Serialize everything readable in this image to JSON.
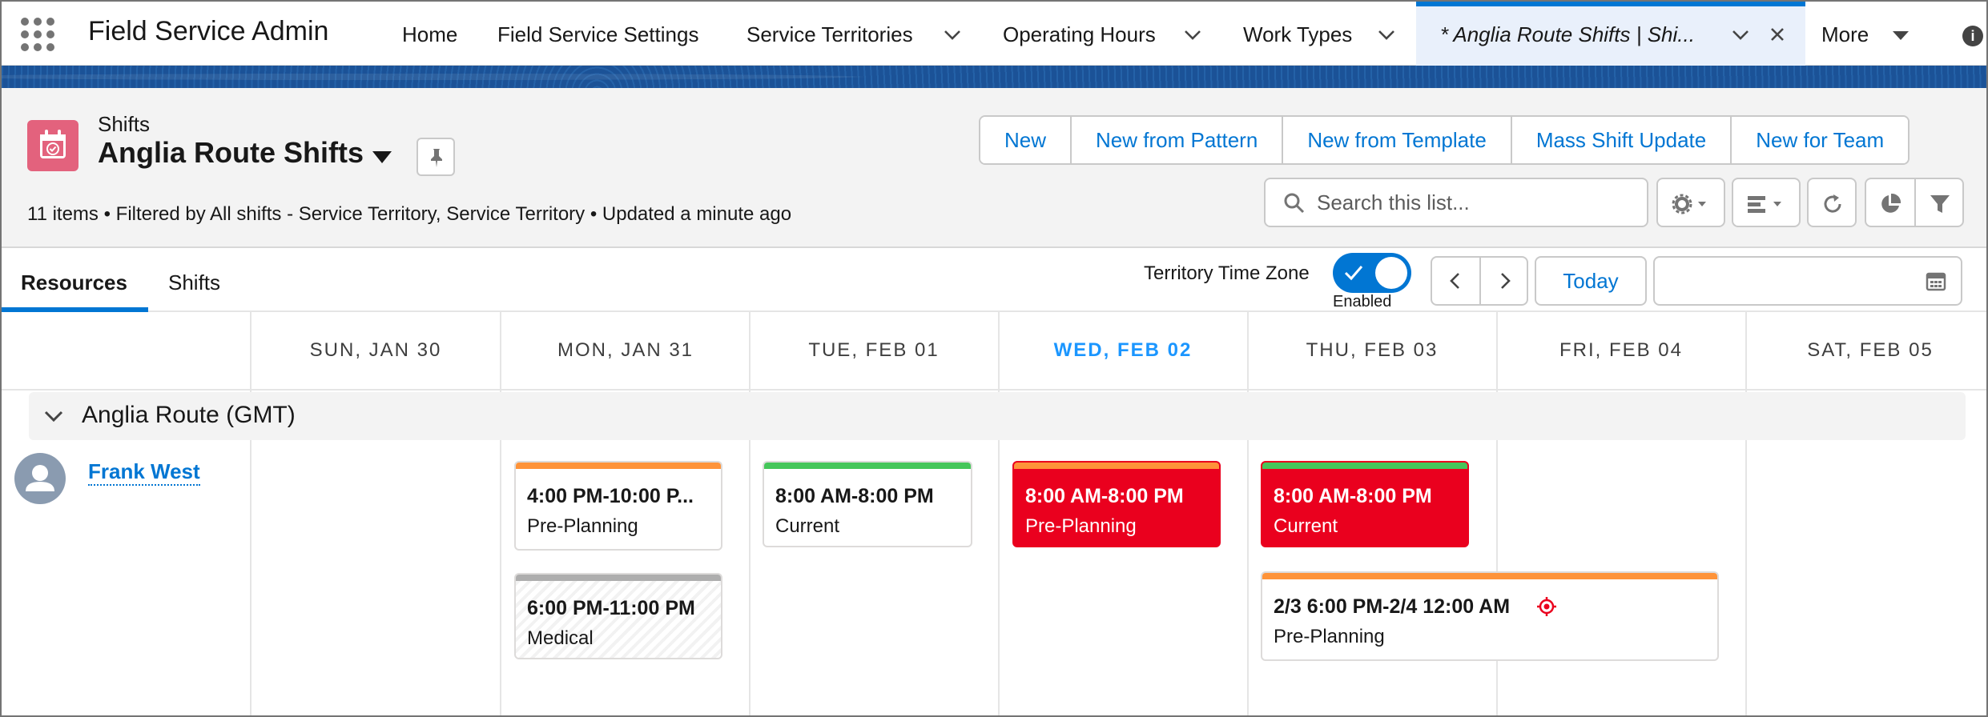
{
  "app": {
    "name": "Field Service Admin"
  },
  "nav": {
    "items": [
      "Home",
      "Field Service Settings",
      "Service Territories",
      "Operating Hours",
      "Work Types"
    ],
    "active_tab": "* Anglia Route Shifts | Shi...",
    "more": "More"
  },
  "header": {
    "object_type": "Shifts",
    "list_name": "Anglia Route Shifts",
    "subinfo": "11 items • Filtered by All shifts - Service Territory, Service Territory • Updated a minute ago",
    "buttons": [
      "New",
      "New from Pattern",
      "New from Template",
      "Mass Shift Update",
      "New for Team"
    ],
    "search_placeholder": "Search this list..."
  },
  "view": {
    "tabs": [
      "Resources",
      "Shifts"
    ],
    "active_tab": "Resources",
    "tz_label": "Territory Time Zone",
    "tz_state": "Enabled",
    "today_label": "Today",
    "date_value": ""
  },
  "calendar": {
    "days": [
      "SUN, JAN 30",
      "MON, JAN 31",
      "TUE, FEB 01",
      "WED, FEB 02",
      "THU, FEB 03",
      "FRI, FEB 04",
      "SAT, FEB 05"
    ],
    "today_index": 3,
    "group": "Anglia Route (GMT)",
    "resource": "Frank West",
    "shifts": [
      {
        "time": "4:00 PM-10:00 P...",
        "status": "Pre-Planning",
        "bar": "#fe9339",
        "style": "normal"
      },
      {
        "time": "6:00 PM-11:00 PM",
        "status": "Medical",
        "bar": "#aeaeae",
        "style": "hatched"
      },
      {
        "time": "8:00 AM-8:00 PM",
        "status": "Current",
        "bar": "#45c65a",
        "style": "normal"
      },
      {
        "time": "8:00 AM-8:00 PM",
        "status": "Pre-Planning",
        "bar": "#fe9339",
        "style": "red"
      },
      {
        "time": "8:00 AM-8:00 PM",
        "status": "Current",
        "bar": "#45c65a",
        "style": "red"
      },
      {
        "time": "2/3 6:00 PM-2/4 12:00 AM",
        "status": "Pre-Planning",
        "bar": "#fe9339",
        "style": "normal",
        "icon": "crosshair-icon"
      }
    ]
  },
  "colors": {
    "brand": "#0176d3",
    "alert": "#ea001e",
    "pre_planning": "#fe9339",
    "current": "#45c65a",
    "medical": "#aeaeae"
  }
}
